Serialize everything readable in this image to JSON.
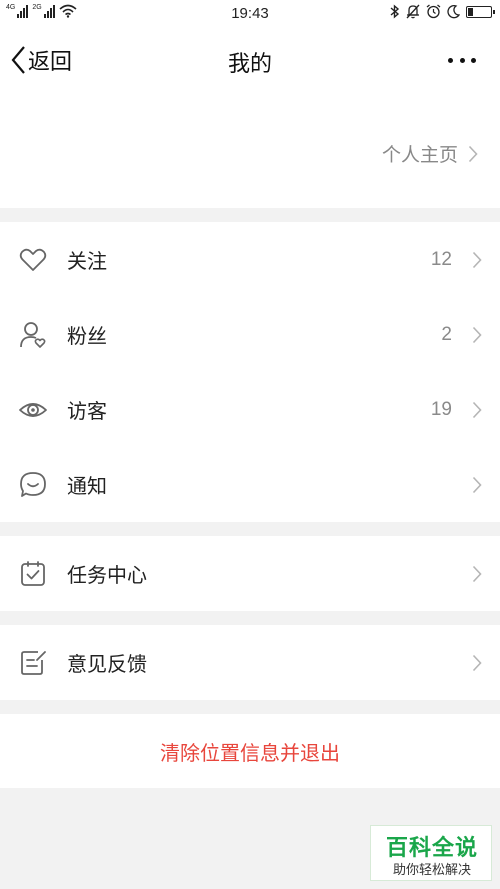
{
  "status_bar": {
    "network1": "4G",
    "network2": "2G",
    "time": "19:43",
    "icons": [
      "bluetooth-icon",
      "mute-bell-icon",
      "alarm-icon",
      "moon-icon",
      "battery-icon"
    ],
    "battery_level": 0.2
  },
  "header": {
    "back_label": "返回",
    "title": "我的",
    "more_icon": "more-dots-icon"
  },
  "profile": {
    "homepage_label": "个人主页"
  },
  "menu": {
    "follow": {
      "label": "关注",
      "count": "12",
      "icon": "heart-icon"
    },
    "fans": {
      "label": "粉丝",
      "count": "2",
      "icon": "user-heart-icon"
    },
    "visitors": {
      "label": "访客",
      "count": "19",
      "icon": "eye-icon"
    },
    "notifications": {
      "label": "通知",
      "icon": "chat-bubble-icon"
    },
    "task_center": {
      "label": "任务中心",
      "icon": "task-check-icon"
    },
    "feedback": {
      "label": "意见反馈",
      "icon": "edit-note-icon"
    }
  },
  "logout_label": "清除位置信息并退出",
  "watermark": {
    "title": "百科全说",
    "subtitle": "助你轻松解决"
  },
  "colors": {
    "danger": "#e8463c",
    "watermark": "#1aa64a",
    "background": "#f2f2f2"
  }
}
